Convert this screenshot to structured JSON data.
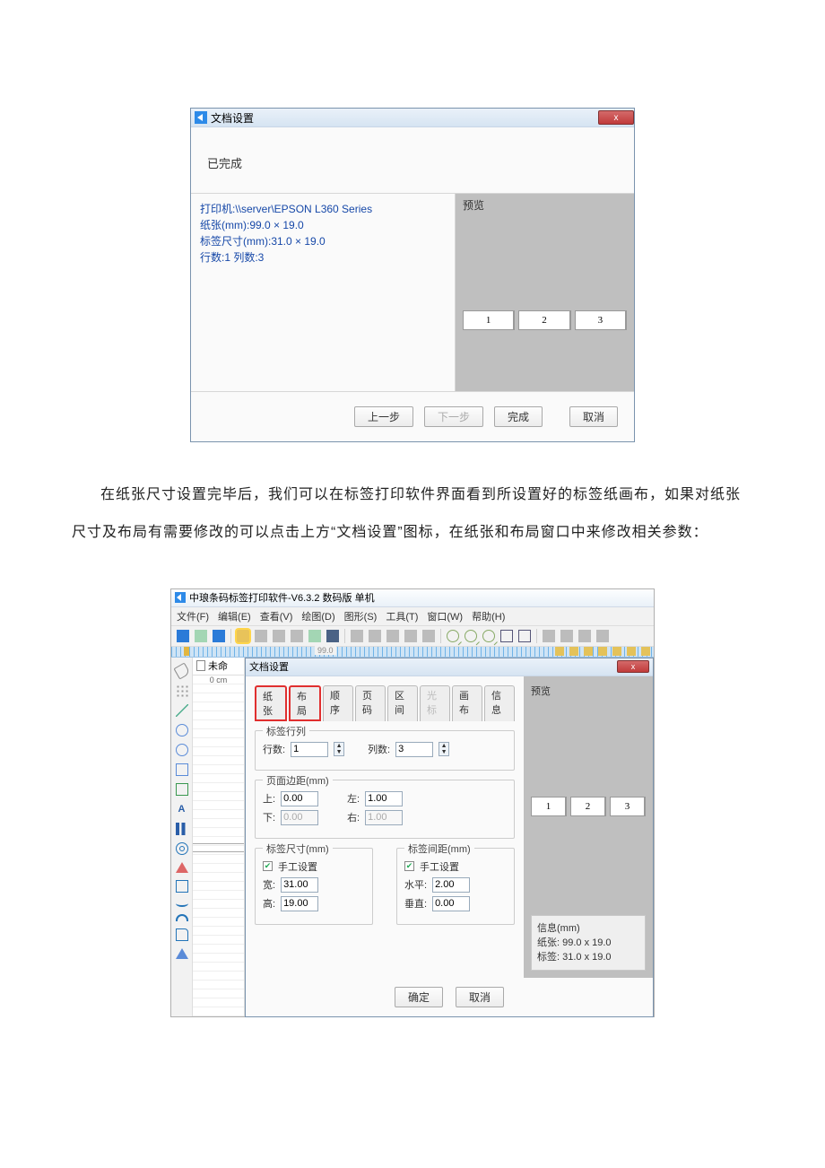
{
  "dialog1": {
    "title": "文档设置",
    "close_x": "x",
    "done": "已完成",
    "printer_line": "打印机:\\\\server\\EPSON L360 Series",
    "paper_line": "纸张(mm):99.0 × 19.0",
    "label_line": "标签尺寸(mm):31.0 × 19.0",
    "rowcol_line": "行数:1 列数:3",
    "preview_title": "预览",
    "labels": [
      "1",
      "2",
      "3"
    ],
    "btn_prev": "上一步",
    "btn_next": "下一步",
    "btn_finish": "完成",
    "btn_cancel": "取消"
  },
  "article": {
    "p1": "在纸张尺寸设置完毕后，我们可以在标签打印软件界面看到所设置好的标签纸画布，如果对纸张尺寸及布局有需要修改的可以点击上方“文档设置”图标，在纸张和布局窗口中来修改相关参数："
  },
  "app": {
    "title": "中琅条码标签打印软件-V6.3.2 数码版 单机",
    "menus": [
      "文件(F)",
      "编辑(E)",
      "查看(V)",
      "绘图(D)",
      "图形(S)",
      "工具(T)",
      "窗口(W)",
      "帮助(H)"
    ],
    "ruler_dim": "99.0",
    "canvas_tab": "未命",
    "canvas_zero": "0 cm",
    "side_letter": "A",
    "inner_dlg": {
      "title": "文档设置",
      "tabs": [
        "纸张",
        "布局",
        "顺序",
        "页码",
        "区间",
        "光标",
        "画布",
        "信息"
      ],
      "preview_title": "预览",
      "labels": [
        "1",
        "2",
        "3"
      ],
      "grp_rowcol": {
        "title": "标签行列",
        "rows_lbl": "行数:",
        "rows_val": "1",
        "cols_lbl": "列数:",
        "cols_val": "3"
      },
      "grp_margin": {
        "title": "页面边距(mm)",
        "top_lbl": "上:",
        "top_val": "0.00",
        "left_lbl": "左:",
        "left_val": "1.00",
        "bottom_lbl": "下:",
        "bottom_val": "0.00",
        "right_lbl": "右:",
        "right_val": "1.00"
      },
      "grp_size": {
        "title": "标签尺寸(mm)",
        "manual": "手工设置",
        "w_lbl": "宽:",
        "w_val": "31.00",
        "h_lbl": "高:",
        "h_val": "19.00"
      },
      "grp_gap": {
        "title": "标签间距(mm)",
        "manual": "手工设置",
        "hz_lbl": "水平:",
        "hz_val": "2.00",
        "vt_lbl": "垂直:",
        "vt_val": "0.00"
      },
      "info_title": "信息(mm)",
      "info_paper": "纸张: 99.0 x 19.0",
      "info_label": "标签: 31.0 x 19.0",
      "btn_ok": "确定",
      "btn_cancel": "取消"
    }
  }
}
